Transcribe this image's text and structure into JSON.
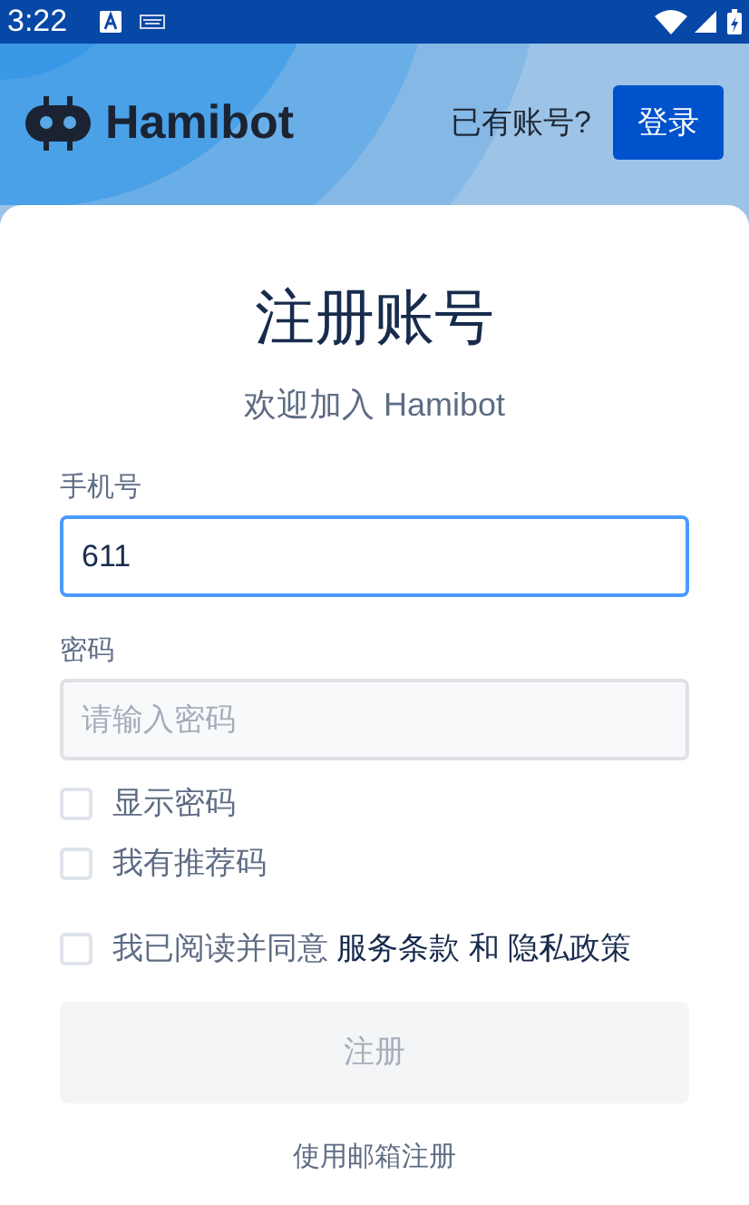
{
  "status_bar": {
    "time": "3:22"
  },
  "header": {
    "logo_text": "Hamibot",
    "prompt": "已有账号?",
    "login_button": "登录"
  },
  "title": "注册账号",
  "subtitle": "欢迎加入 Hamibot",
  "fields": [
    {
      "label": "手机号",
      "value": "611",
      "focused": true
    },
    {
      "label": "密码",
      "placeholder": "请输入密码",
      "focused": false
    }
  ],
  "checkboxes": [
    {
      "label": "显示密码",
      "checked": false
    },
    {
      "label": "我有推荐码",
      "checked": false
    }
  ],
  "agreement": {
    "checked": false,
    "text": "我已阅读并同意",
    "terms": "服务条款",
    "conjunction": "和",
    "privacy": "隐私政策"
  },
  "submit": {
    "label": "注册",
    "disabled": true
  },
  "alt_link": "使用邮箱注册"
}
